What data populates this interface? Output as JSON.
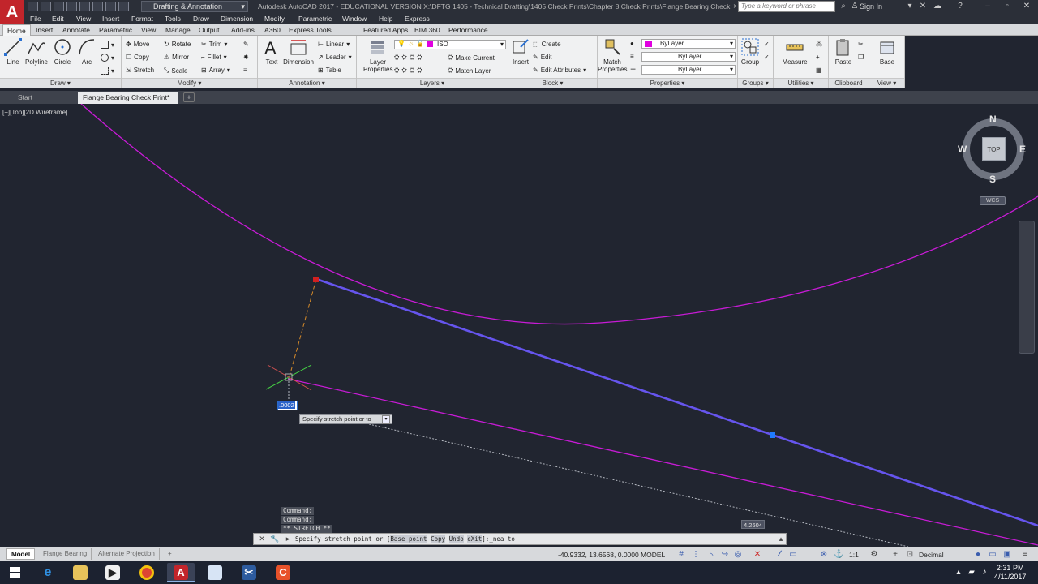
{
  "titlebar": {
    "logo": "A",
    "workspace": "Drafting & Annotation",
    "document_title": "Autodesk AutoCAD 2017 - EDUCATIONAL VERSION    X:\\DFTG 1405 - Technical Drafting\\1405 Check Prints\\Chapter 8 Check Prints\\Flange Bearing Check Print.dwg",
    "search_placeholder": "Type a keyword or phrase",
    "sign_in": "Sign In"
  },
  "menu": [
    "File",
    "Edit",
    "View",
    "Insert",
    "Format",
    "Tools",
    "Draw",
    "Dimension",
    "Modify",
    "Parametric",
    "Window",
    "Help",
    "Express"
  ],
  "ribbon_tabs": [
    "Home",
    "Insert",
    "Annotate",
    "Parametric",
    "View",
    "Manage",
    "Output",
    "Add-ins",
    "A360",
    "Express Tools",
    "Featured Apps",
    "BIM 360",
    "Performance"
  ],
  "ribbon": {
    "draw": {
      "title": "Draw",
      "line": "Line",
      "polyline": "Polyline",
      "circle": "Circle",
      "arc": "Arc"
    },
    "modify": {
      "title": "Modify",
      "move": "Move",
      "rotate": "Rotate",
      "trim": "Trim",
      "copy": "Copy",
      "mirror": "Mirror",
      "fillet": "Fillet",
      "stretch": "Stretch",
      "scale": "Scale",
      "array": "Array"
    },
    "annotation": {
      "title": "Annotation",
      "text": "Text",
      "dimension": "Dimension",
      "linear": "Linear",
      "leader": "Leader",
      "table": "Table"
    },
    "layers": {
      "title": "Layers",
      "layer_properties_1": "Layer",
      "layer_properties_2": "Properties",
      "layer_combo": "ISO",
      "make_current": "Make Current",
      "match_layer": "Match Layer"
    },
    "block": {
      "title": "Block",
      "insert": "Insert",
      "create": "Create",
      "edit": "Edit",
      "edit_attributes": "Edit Attributes"
    },
    "properties": {
      "title": "Properties",
      "match_1": "Match",
      "match_2": "Properties",
      "color": "ByLayer",
      "linetype": "ByLayer",
      "lineweight": "ByLayer"
    },
    "groups": {
      "title": "Groups",
      "group": "Group"
    },
    "utilities": {
      "title": "Utilities",
      "measure": "Measure"
    },
    "clipboard": {
      "title": "Clipboard",
      "paste": "Paste"
    },
    "view": {
      "title": "View",
      "base": "Base"
    }
  },
  "file_tabs": {
    "start": "Start",
    "active": "Flange Bearing Check Print*",
    "plus": "+"
  },
  "viewport": {
    "label": "[−][Top][2D Wireframe]",
    "cube": {
      "top": "TOP",
      "n": "N",
      "s": "S",
      "e": "E",
      "w": "W",
      "wcs": "WCS"
    },
    "dyn_input": ".0002",
    "prompt_tip": "Specify stretch point or to",
    "dim_label": "4.2604"
  },
  "command": {
    "history": [
      "Command:",
      "Command:",
      "** STRETCH **"
    ],
    "prefix": "Specify stretch point or [",
    "opt_base": "Base point",
    "opt_copy": "Copy",
    "opt_undo": "Undo",
    "opt_exit": "eXit",
    "suffix": "]:_nea to"
  },
  "status": {
    "layout_tabs": [
      "Model",
      "Flange Bearing",
      "Alternate Projection"
    ],
    "coords": "-40.9332, 13.6568, 0.0000",
    "model": "MODEL",
    "scale": "1:1",
    "units": "Decimal"
  },
  "taskbar": {
    "time": "2:31 PM",
    "date": "4/11/2017"
  },
  "colors": {
    "canvas": "#212530",
    "magenta": "#c81bd6",
    "selected_line": "#6655ee",
    "grip": "#1f7bff"
  }
}
